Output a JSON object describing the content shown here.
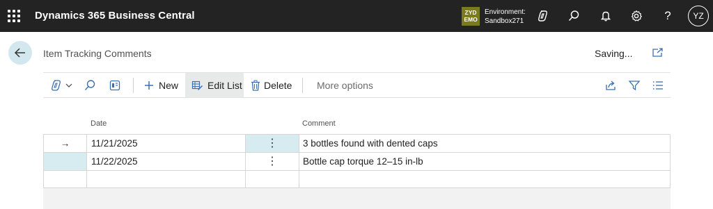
{
  "app": {
    "title": "Dynamics 365 Business Central"
  },
  "environment": {
    "badge_line1": "ZYD",
    "badge_line2": "EMO",
    "label": "Environment:",
    "name": "Sandbox271",
    "badge_color": "#7a7a1f"
  },
  "user": {
    "initials": "YZ"
  },
  "page": {
    "title": "Item Tracking Comments",
    "status": "Saving..."
  },
  "actions": {
    "new_label": "New",
    "edit_list_label": "Edit List",
    "delete_label": "Delete",
    "more_label": "More options"
  },
  "table": {
    "columns": {
      "date": "Date",
      "comment": "Comment"
    },
    "rows": [
      {
        "indicator": "→",
        "date": "11/21/2025",
        "comment": "3 bottles found with dented caps"
      },
      {
        "indicator": "",
        "date": "11/22/2025",
        "comment": "Bottle cap torque 12–15 in-lb"
      },
      {
        "indicator": "",
        "date": "",
        "comment": ""
      }
    ]
  },
  "colors": {
    "topbar": "#232323",
    "accent": "#d6ecf0",
    "action_active": "#e8eaea"
  }
}
